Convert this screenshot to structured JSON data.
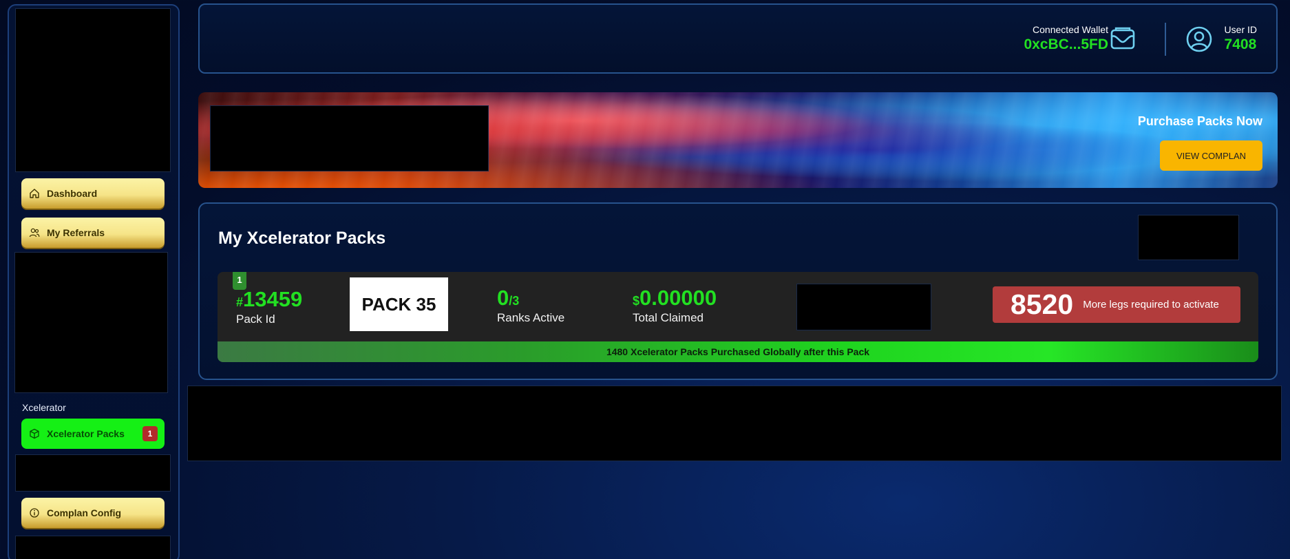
{
  "sidebar": {
    "items": [
      {
        "label": "Dashboard",
        "icon": "home-icon"
      },
      {
        "label": "My Referrals",
        "icon": "users-icon"
      }
    ],
    "section_label": "Xcelerator",
    "xcelerator_item": {
      "label": "Xcelerator Packs",
      "icon": "box-icon",
      "badge": "1"
    },
    "config_item": {
      "label": "Complan Config",
      "icon": "info-icon"
    }
  },
  "header": {
    "wallet_label": "Connected Wallet",
    "wallet_value": "0xcBC...5FD",
    "user_label": "User ID",
    "user_value": "7408"
  },
  "banner": {
    "title": "Purchase Packs Now",
    "button_label": "VIEW COMPLAN"
  },
  "packs": {
    "title": "My Xcelerator Packs",
    "items": [
      {
        "index": "1",
        "pack_id_prefix": "#",
        "pack_id": "13459",
        "pack_id_label": "Pack Id",
        "pack_name": "PACK 35",
        "ranks_active": "0",
        "ranks_total": "/3",
        "ranks_label": "Ranks Active",
        "claimed_prefix": "$",
        "claimed_value": "0.00000",
        "claimed_label": "Total Claimed",
        "legs_required": "8520",
        "legs_text": "More legs required to activate",
        "global_note": "1480 Xcelerator Packs Purchased Globally after this Pack"
      }
    ]
  },
  "colors": {
    "accent_green": "#22e022",
    "gold_button": "#f9b500",
    "alert_red": "#b23c3c",
    "border_blue": "#27538d"
  }
}
